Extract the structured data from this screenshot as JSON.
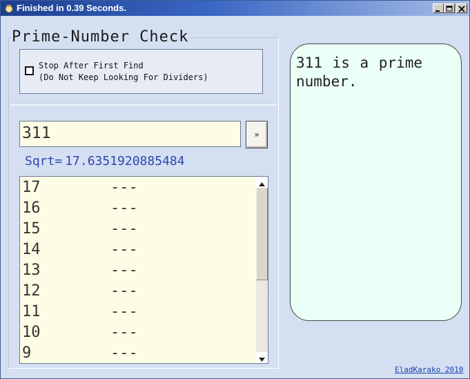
{
  "window": {
    "title": "Finished in 0.39 Seconds.",
    "icon": "app-icon",
    "controls": [
      "minimize-icon",
      "maximize-icon",
      "close-icon"
    ]
  },
  "group": {
    "title": "Prime-Number Check",
    "stop_option": {
      "checked": false,
      "line1": "Stop After First Find",
      "line2": "(Do Not Keep Looking For Dividers)"
    }
  },
  "input": {
    "value": "311"
  },
  "go_button": {
    "label": "»"
  },
  "sqrt": {
    "label": "Sqrt=",
    "value": "17.6351920885484"
  },
  "divisor_list": {
    "rows": [
      {
        "n": "17",
        "r": "---"
      },
      {
        "n": "16",
        "r": "---"
      },
      {
        "n": "15",
        "r": "---"
      },
      {
        "n": "14",
        "r": "---"
      },
      {
        "n": "13",
        "r": "---"
      },
      {
        "n": "12",
        "r": "---"
      },
      {
        "n": "11",
        "r": "---"
      },
      {
        "n": "10",
        "r": "---"
      },
      {
        "n": "9",
        "r": "---"
      }
    ]
  },
  "result": {
    "line1": "311 is a prime",
    "line2": "number."
  },
  "footer": {
    "credit": "EladKarako 2010"
  },
  "colors": {
    "window_bg": "#d4e0f2",
    "input_bg": "#fdfde6",
    "result_bg": "#eafff6",
    "accent_text": "#2f45b0",
    "titlebar": "#1c3f8f"
  }
}
